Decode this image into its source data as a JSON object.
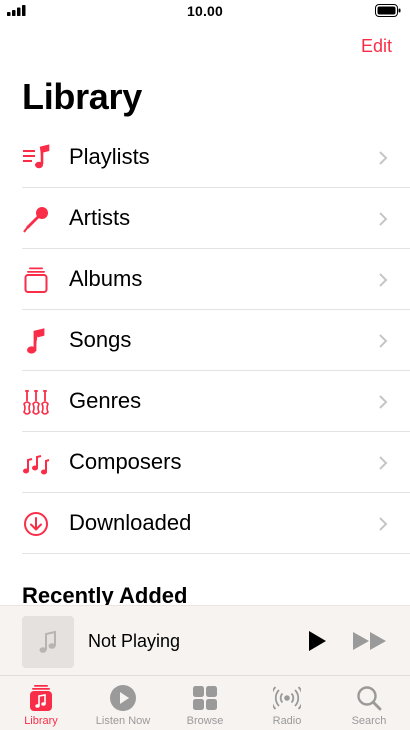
{
  "status_bar": {
    "time": "10.00"
  },
  "nav": {
    "edit_label": "Edit"
  },
  "page": {
    "title": "Library"
  },
  "library_items": [
    {
      "label": "Playlists",
      "icon": "playlist-icon"
    },
    {
      "label": "Artists",
      "icon": "microphone-icon"
    },
    {
      "label": "Albums",
      "icon": "album-stack-icon"
    },
    {
      "label": "Songs",
      "icon": "music-note-icon"
    },
    {
      "label": "Genres",
      "icon": "guitars-icon"
    },
    {
      "label": "Composers",
      "icon": "music-notes-icon"
    },
    {
      "label": "Downloaded",
      "icon": "download-circle-icon"
    }
  ],
  "sections": {
    "recently_added": "Recently Added"
  },
  "mini_player": {
    "title": "Not Playing"
  },
  "tabs": [
    {
      "label": "Library",
      "icon": "library-icon",
      "active": true
    },
    {
      "label": "Listen Now",
      "icon": "play-circle-icon",
      "active": false
    },
    {
      "label": "Browse",
      "icon": "grid-icon",
      "active": false
    },
    {
      "label": "Radio",
      "icon": "radio-waves-icon",
      "active": false
    },
    {
      "label": "Search",
      "icon": "search-icon",
      "active": false
    }
  ],
  "colors": {
    "accent": "#fa2d48",
    "separator": "#e3e3e6",
    "inactive_tab": "#9a9a9a"
  }
}
